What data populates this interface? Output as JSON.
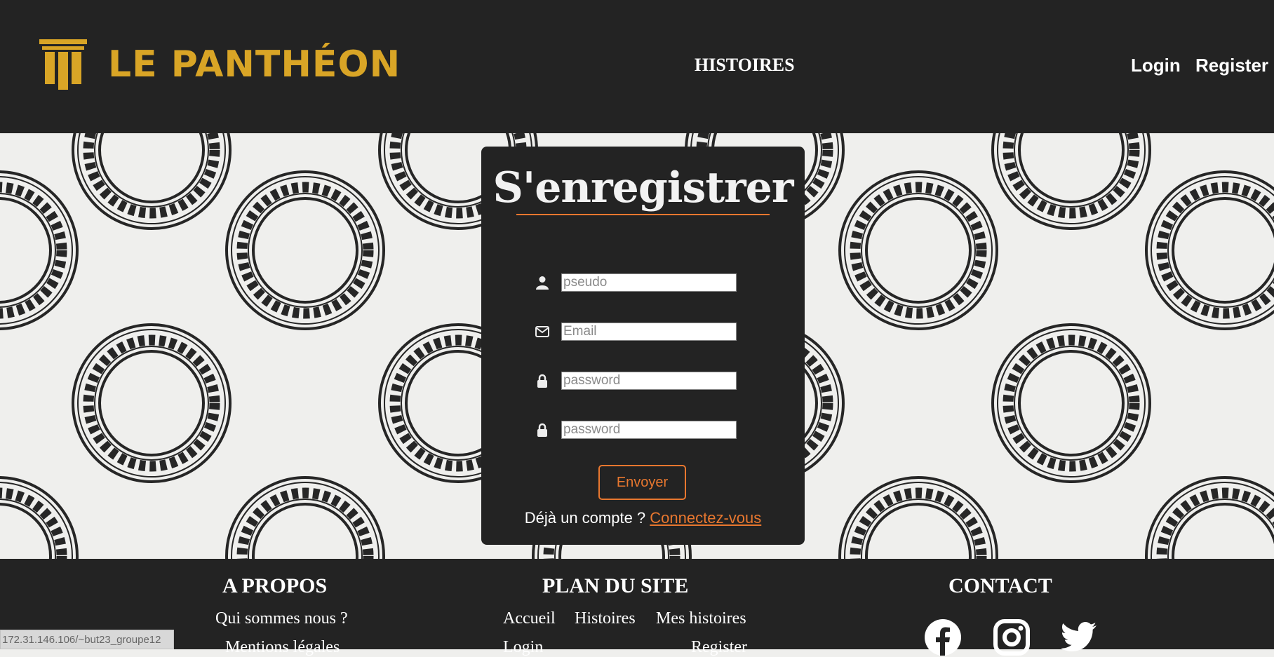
{
  "header": {
    "logo_text": "LE PANTHÉON",
    "nav": {
      "histoires": "HISTOIRES",
      "login": "Login",
      "register": "Register"
    }
  },
  "form": {
    "title": "S'enregistrer",
    "fields": [
      {
        "icon": "user-icon",
        "placeholder": "pseudo",
        "value": ""
      },
      {
        "icon": "envelope-icon",
        "placeholder": "Email",
        "value": ""
      },
      {
        "icon": "lock-icon",
        "placeholder": "password",
        "value": ""
      },
      {
        "icon": "lock-icon",
        "placeholder": "password",
        "value": ""
      }
    ],
    "submit_label": "Envoyer",
    "already_text": "Déjà un compte ?",
    "connect_label": "Connectez-vous"
  },
  "footer": {
    "about": {
      "title": "A PROPOS",
      "links": [
        "Qui sommes nous ?",
        "Mentions légales"
      ]
    },
    "sitemap": {
      "title": "PLAN DU SITE",
      "links": [
        "Accueil",
        "Histoires",
        "Mes histoires",
        "Login",
        "Register"
      ]
    },
    "contact": {
      "title": "CONTACT",
      "icons": [
        "facebook-icon",
        "instagram-icon",
        "twitter-icon"
      ]
    }
  },
  "status_url": "172.31.146.106/~but23_groupe12",
  "colors": {
    "dark": "#232323",
    "gold": "#d9a526",
    "accent": "#e8772f",
    "background": "#efefed"
  }
}
